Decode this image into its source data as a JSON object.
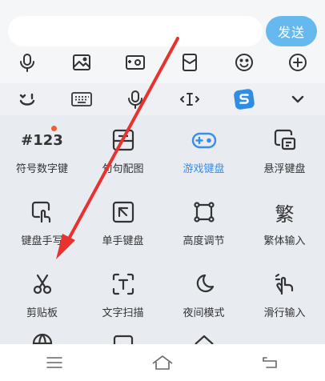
{
  "composer": {
    "placeholder": "",
    "value": "",
    "send_label": "发送"
  },
  "grid": {
    "row1": [
      {
        "label": "符号数字键",
        "icon_text": "#123"
      },
      {
        "label": "句句配图"
      },
      {
        "label": "游戏键盘"
      },
      {
        "label": "悬浮键盘"
      }
    ],
    "row2": [
      {
        "label": "键盘手写"
      },
      {
        "label": "单手键盘"
      },
      {
        "label": "高度调节"
      },
      {
        "label": "繁体输入",
        "icon_text": "繁"
      }
    ],
    "row3": [
      {
        "label": "剪贴板"
      },
      {
        "label": "文字扫描"
      },
      {
        "label": "夜间模式"
      },
      {
        "label": "滑行输入"
      }
    ]
  },
  "colors": {
    "accent": "#3a8ee6",
    "send_button": "#66b9ef",
    "annotation_arrow": "#e8322f",
    "notification_dot": "#f25c2e"
  },
  "icons": {
    "chat_tools": [
      "microphone-icon",
      "image-icon",
      "camera-icon",
      "red-envelope-icon",
      "emoji-icon",
      "plus-icon"
    ],
    "keyboard_toolbar": [
      "smile-logo-icon",
      "keyboard-icon",
      "microphone-icon",
      "cursor-icon",
      "sogou-logo-icon",
      "chevron-down-icon"
    ],
    "navbar": [
      "menu-icon",
      "home-icon",
      "back-icon"
    ]
  }
}
